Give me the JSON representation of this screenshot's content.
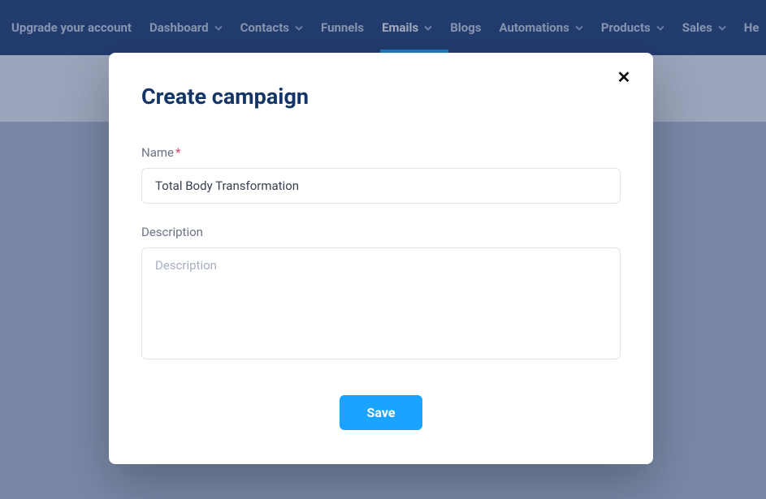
{
  "nav": {
    "upgrade": "Upgrade your account",
    "items": [
      {
        "label": "Dashboard",
        "dropdown": true,
        "active": false
      },
      {
        "label": "Contacts",
        "dropdown": true,
        "active": false
      },
      {
        "label": "Funnels",
        "dropdown": false,
        "active": false
      },
      {
        "label": "Emails",
        "dropdown": true,
        "active": true
      },
      {
        "label": "Blogs",
        "dropdown": false,
        "active": false
      },
      {
        "label": "Automations",
        "dropdown": true,
        "active": false
      },
      {
        "label": "Products",
        "dropdown": true,
        "active": false
      },
      {
        "label": "Sales",
        "dropdown": true,
        "active": false
      },
      {
        "label": "He",
        "dropdown": false,
        "active": false
      }
    ]
  },
  "modal": {
    "title": "Create campaign",
    "close_glyph": "✕",
    "name_label": "Name",
    "name_value": "Total Body Transformation",
    "description_label": "Description",
    "description_placeholder": "Description",
    "description_value": "",
    "save_label": "Save"
  }
}
